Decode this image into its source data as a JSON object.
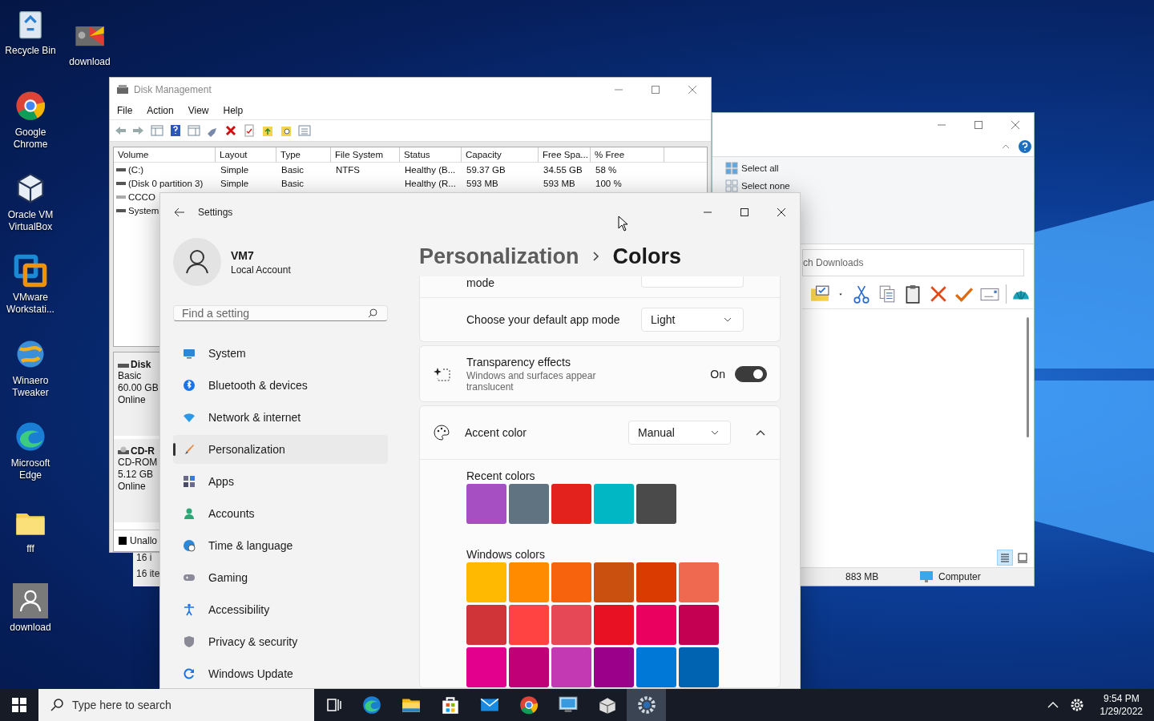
{
  "desktop_icons": [
    {
      "label": "Recycle Bin"
    },
    {
      "label": "download"
    },
    {
      "label": "Google Chrome"
    },
    {
      "label": "Oracle VM VirtualBox"
    },
    {
      "label": "VMware Workstati..."
    },
    {
      "label": "Winaero Tweaker"
    },
    {
      "label": "Microsoft Edge"
    },
    {
      "label": "fff"
    },
    {
      "label": "download"
    }
  ],
  "background_window": {
    "status_lines": [
      "16 i",
      "16 ite"
    ]
  },
  "explorer": {
    "selection_commands": [
      "Select all",
      "Select none"
    ],
    "search": {
      "placeholder": "ch Downloads"
    },
    "view_buttons": [
      {
        "selected": true
      },
      {
        "selected": false
      }
    ],
    "status_bar": {
      "size": "883 MB",
      "location": "Computer"
    }
  },
  "disk_management": {
    "title": "Disk Management",
    "menu": [
      "File",
      "Action",
      "View",
      "Help"
    ],
    "table": {
      "columns": [
        "Volume",
        "Layout",
        "Type",
        "File System",
        "Status",
        "Capacity",
        "Free Spa...",
        "% Free"
      ],
      "rows": [
        {
          "volume": "(C:)",
          "layout": "Simple",
          "type": "Basic",
          "file_system": "NTFS",
          "status": "Healthy (B...",
          "capacity": "59.37 GB",
          "free_space": "34.55 GB",
          "percent_free": "58 %"
        },
        {
          "volume": "(Disk 0 partition 3)",
          "layout": "Simple",
          "type": "Basic",
          "status": "Healthy (R...",
          "capacity": "593 MB",
          "free_space": "593 MB",
          "percent_free": "100 %"
        },
        {
          "volume": "CCCO"
        },
        {
          "volume": "System"
        }
      ]
    },
    "disks": [
      {
        "name": "Disk",
        "lines": [
          "Basic",
          "60.00 GB",
          "Online"
        ]
      },
      {
        "name": "CD-R",
        "lines": [
          "CD-ROM",
          "5.12 GB",
          "Online"
        ]
      }
    ],
    "legend": "Unallo"
  },
  "settings": {
    "title": "Settings",
    "user": {
      "name": "VM7",
      "account": "Local Account"
    },
    "search": {
      "placeholder": "Find a setting"
    },
    "nav": [
      {
        "label": "System",
        "selected": false
      },
      {
        "label": "Bluetooth & devices",
        "selected": false
      },
      {
        "label": "Network & internet",
        "selected": false
      },
      {
        "label": "Personalization",
        "selected": true
      },
      {
        "label": "Apps",
        "selected": false
      },
      {
        "label": "Accounts",
        "selected": false
      },
      {
        "label": "Time & language",
        "selected": false
      },
      {
        "label": "Gaming",
        "selected": false
      },
      {
        "label": "Accessibility",
        "selected": false
      },
      {
        "label": "Privacy & security",
        "selected": false
      },
      {
        "label": "Windows Update",
        "selected": false
      }
    ],
    "breadcrumb": {
      "parent": "Personalization",
      "current": "Colors"
    },
    "partial_row_label": "mode",
    "app_mode": {
      "label": "Choose your default app mode",
      "value": "Light"
    },
    "transparency": {
      "title": "Transparency effects",
      "description": "Windows and surfaces appear translucent",
      "state_label": "On",
      "on": true
    },
    "accent": {
      "label": "Accent color",
      "value": "Manual",
      "expanded": true
    },
    "recent_colors": {
      "title": "Recent colors",
      "swatches": [
        {
          "color": "#a64fc2"
        },
        {
          "color": "#5f7381"
        },
        {
          "color": "#e3221d"
        },
        {
          "color": "#00b7c3"
        },
        {
          "color": "#4a4a4a"
        }
      ]
    },
    "windows_colors": {
      "title": "Windows colors",
      "swatches": [
        {
          "color": "#ffb900"
        },
        {
          "color": "#ff8c00"
        },
        {
          "color": "#f7630c"
        },
        {
          "color": "#ca5010"
        },
        {
          "color": "#da3b01"
        },
        {
          "color": "#ef6950"
        },
        {
          "color": "#d13438"
        },
        {
          "color": "#ff4343"
        },
        {
          "color": "#e74856"
        },
        {
          "color": "#e81123"
        },
        {
          "color": "#ea005e"
        },
        {
          "color": "#c30052"
        },
        {
          "color": "#e3008c"
        },
        {
          "color": "#bf0077"
        },
        {
          "color": "#c239b3"
        },
        {
          "color": "#9a0089"
        },
        {
          "color": "#0078d7"
        },
        {
          "color": "#0063b1"
        }
      ]
    }
  },
  "taskbar": {
    "search_placeholder": "Type here to search",
    "time": "9:54 PM",
    "date": "1/29/2022"
  }
}
